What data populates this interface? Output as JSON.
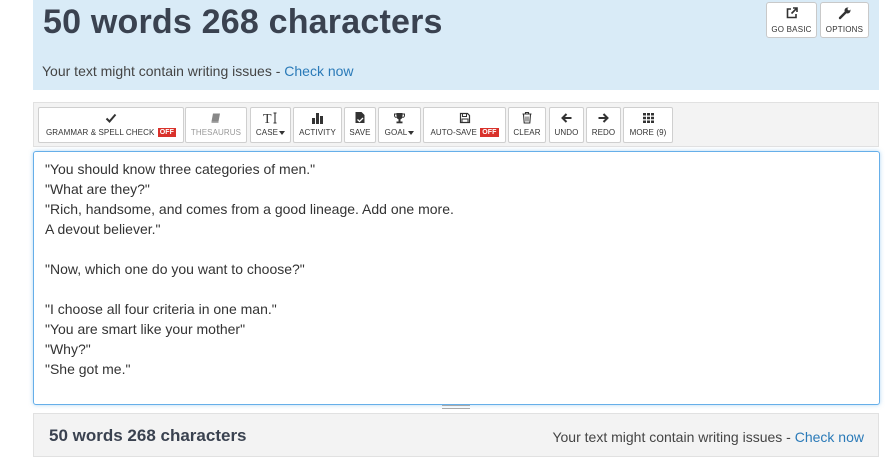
{
  "header": {
    "title": "50 words 268 characters",
    "issues_text": "Your text might contain writing issues - ",
    "check_now": "Check now",
    "go_basic": "GO BASIC",
    "options": "OPTIONS"
  },
  "toolbar": {
    "grammar": "GRAMMAR & SPELL CHECK",
    "off": "OFF",
    "thesaurus": "THESAURUS",
    "case": "CASE",
    "activity": "ACTIVITY",
    "save": "SAVE",
    "goal": "GOAL",
    "autosave": "AUTO-SAVE",
    "clear": "CLEAR",
    "undo": "UNDO",
    "redo": "REDO",
    "more": "MORE (9)"
  },
  "editor": {
    "text": "\"You should know three categories of men.\"\n\"What are they?\"\n\"Rich, handsome, and comes from a good lineage. Add one more.\nA devout believer.\"\n\n\"Now, which one do you want to choose?\"\n\n\"I choose all four criteria in one man.\"\n\"You are smart like your mother\"\n\"Why?\"\n\"She got me.\""
  },
  "footer": {
    "counts": "50 words 268 characters",
    "issues_text": "Your text might contain writing issues - ",
    "check_now": "Check now"
  },
  "icons": {
    "grammar": "checkmark-icon",
    "thesaurus": "book-icon",
    "case": "text-case-icon",
    "activity": "bar-chart-icon",
    "save": "save-file-icon",
    "goal": "trophy-icon",
    "autosave": "floppy-icon",
    "clear": "trash-icon",
    "undo": "arrow-left-icon",
    "redo": "arrow-right-icon",
    "more": "grid-icon",
    "go_basic": "external-link-icon",
    "options": "wrench-icon"
  },
  "colors": {
    "header_bg": "#d9ebf7",
    "link": "#2a7ab8",
    "off_badge": "#d9322b",
    "editor_focus": "#66afe9"
  }
}
